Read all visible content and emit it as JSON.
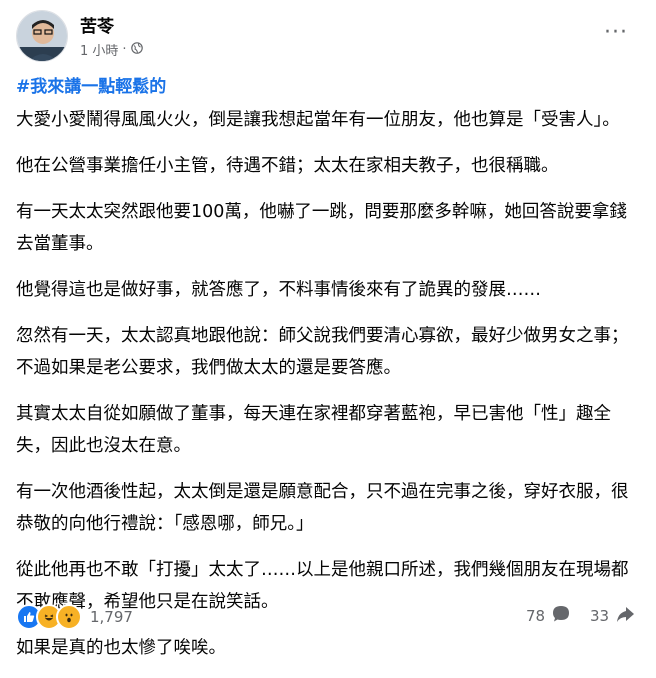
{
  "author": "苦苓",
  "meta": {
    "time": "1 小時",
    "separator": "·"
  },
  "more_label": "···",
  "hashtag": "#我來講一點輕鬆的",
  "paragraphs": [
    "￼大愛小愛鬧得風風火火，倒是讓我想起當年有一位朋友，他也算是「受害人」。",
    "他在公營事業擔任小主管，待遇不錯；太太在家相夫教子，也很稱職。",
    "有一天太太突然跟他要100萬，他嚇了一跳，問要那麼多幹嘛，她回答說要拿錢去當董事。",
    "他覺得這也是做好事，就答應了，不料事情後來有了詭異的發展……",
    "忽然有一天，太太認真地跟他說：師父說我們要清心寡欲，最好少做男女之事；￼不過如果是老公要求，我們做太太的還是要答應。",
    "其實太太自從如願做了董事，每天連在家裡都穿著藍袍，早已害他「性」趣全失，因此也沒太在意。",
    "有一次他酒後性起，太太倒是還是願意配合，只不過在完事之後，穿好衣服，很恭敬的向他行禮說：「感恩哪，師兄。」",
    "從此他再也不敢「打擾」太太了……￼以上是他親口所述，￼我們幾個朋友￼在現場都不敢應聲，希望他只是在說笑話。",
    "如果是真的也太慘了唉唉。"
  ],
  "reactions": {
    "count": "1,797",
    "types": [
      "like",
      "haha",
      "wow"
    ]
  },
  "comments_count": "78",
  "shares_count": "33"
}
